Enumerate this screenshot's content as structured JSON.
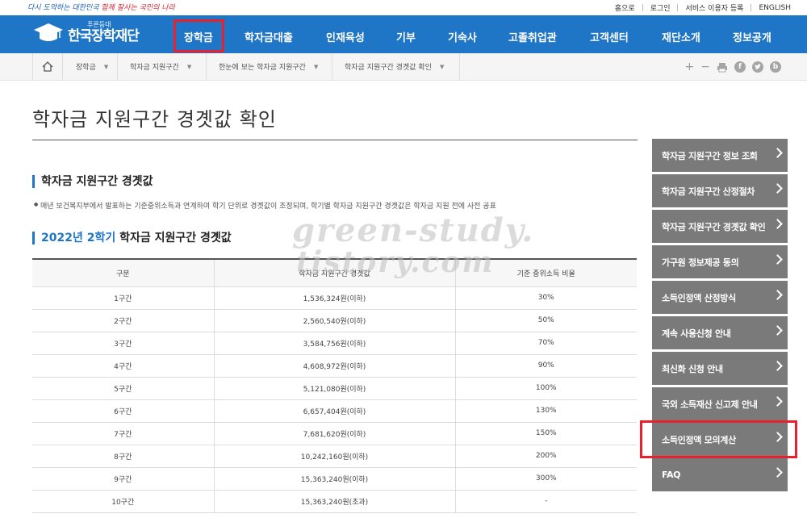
{
  "topbar": {
    "slogan_blue": "다시 도약하는 대한민국",
    "slogan_red": "함께 잘사는",
    "slogan_end": "국민의 나라",
    "links": [
      "홈으로",
      "로그인",
      "서비스 이용자 등록",
      "ENGLISH"
    ]
  },
  "nav": {
    "logo_small": "푸른등대",
    "logo_big": "한국장학재단",
    "items": [
      "장학금",
      "학자금대출",
      "인재육성",
      "기부",
      "기숙사",
      "고졸취업관",
      "고객센터",
      "재단소개",
      "정보공개"
    ]
  },
  "breadcrumb": [
    "장학금",
    "학자금 지원구간",
    "한눈에 보는 학자금 지원구간",
    "학자금 지원구간 경곗값 확인"
  ],
  "page": {
    "title": "학자금 지원구간 경곗값 확인",
    "section1": "학자금 지원구간 경곗값",
    "note": "매년 보건복지부에서 발표하는 기준중위소득과 연계하여 학기 단위로 경곗값이 조정되며, 학기별 학자금 지원구간 경곗값은 학자금 지원 전에 사전 공표",
    "section2_year": "2022년 2학기",
    "section2_rest": "학자금 지원구간 경곗값"
  },
  "watermark": [
    "green-study.",
    "tistory.com"
  ],
  "table": {
    "headers": [
      "구분",
      "학자금 지원구간 경곗값",
      "기준 중위소득 비율"
    ],
    "rows": [
      [
        "1구간",
        "1,536,324원(이하)",
        "30%"
      ],
      [
        "2구간",
        "2,560,540원(이하)",
        "50%"
      ],
      [
        "3구간",
        "3,584,756원(이하)",
        "70%"
      ],
      [
        "4구간",
        "4,608,972원(이하)",
        "90%"
      ],
      [
        "5구간",
        "5,121,080원(이하)",
        "100%"
      ],
      [
        "6구간",
        "6,657,404원(이하)",
        "130%"
      ],
      [
        "7구간",
        "7,681,620원(이하)",
        "150%"
      ],
      [
        "8구간",
        "10,242,160원(이하)",
        "200%"
      ],
      [
        "9구간",
        "15,363,240원(이하)",
        "300%"
      ],
      [
        "10구간",
        "15,363,240원(초과)",
        "-"
      ]
    ]
  },
  "side_menu": [
    "학자금 지원구간 정보 조회",
    "학자금 지원구간 산정절차",
    "학자금 지원구간 경곗값 확인",
    "가구원 정보제공 동의",
    "소득인정액 산정방식",
    "계속 사용신청 안내",
    "최신화 신청 안내",
    "국외 소득재산 신고제 안내",
    "소득인정액 모의계산",
    "FAQ"
  ],
  "tools": {
    "plus": "+",
    "minus": "−",
    "facebook": "f",
    "blog": "b"
  },
  "colors": {
    "nav_blue": "#1f75c6",
    "highlight_red": "#e8212c",
    "side_gray": "#7a7a7a"
  }
}
